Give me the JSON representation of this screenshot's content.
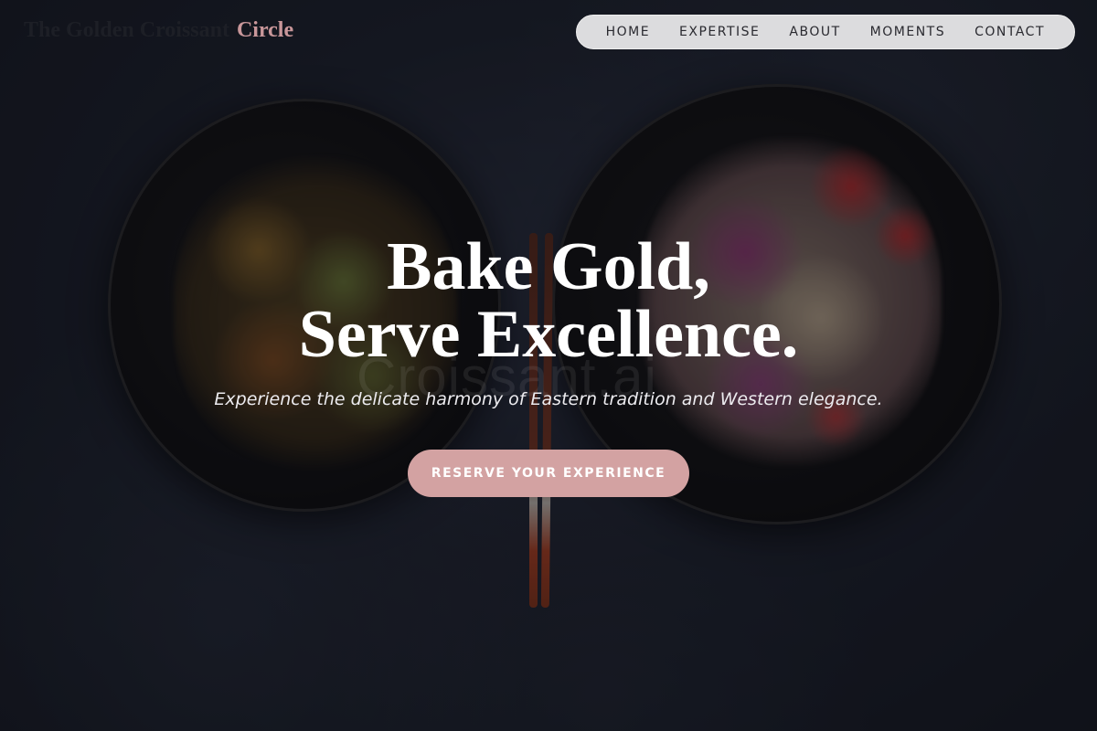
{
  "brand": {
    "name_main": "The Golden Croissant",
    "name_accent": "Circle"
  },
  "nav": {
    "items": [
      {
        "label": "HOME"
      },
      {
        "label": "EXPERTISE"
      },
      {
        "label": "ABOUT"
      },
      {
        "label": "MOMENTS"
      },
      {
        "label": "CONTACT"
      }
    ]
  },
  "hero": {
    "title_line1": "Bake Gold,",
    "title_line2": "Serve Excellence.",
    "subtitle": "Experience the delicate harmony of Eastern tradition and Western elegance.",
    "cta_label": "RESERVE YOUR EXPERIENCE",
    "watermark": "Croissant.ai"
  },
  "colors": {
    "accent": "#d3a2a2",
    "nav_bg": "#dcdcde",
    "background": "#1c212c"
  }
}
